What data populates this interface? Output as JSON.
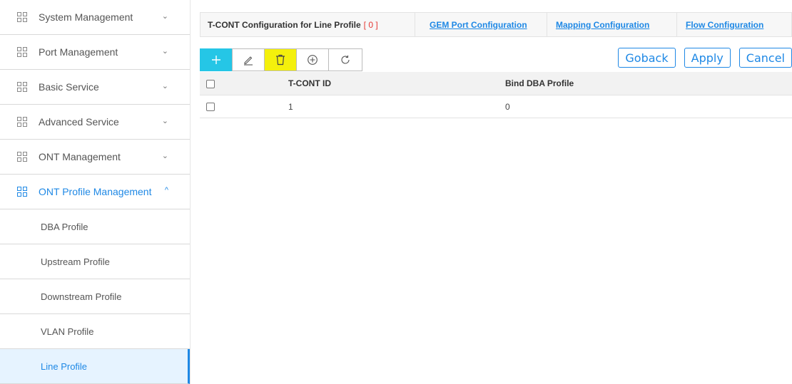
{
  "sidebar": {
    "items": [
      {
        "label": "System Management",
        "chevron": "⌄"
      },
      {
        "label": "Port Management",
        "chevron": "⌄"
      },
      {
        "label": "Basic Service",
        "chevron": "⌄"
      },
      {
        "label": "Advanced Service",
        "chevron": "⌄"
      },
      {
        "label": "ONT Management",
        "chevron": "⌄"
      },
      {
        "label": "ONT Profile Management",
        "chevron": "^"
      }
    ],
    "subitems": [
      {
        "label": "DBA Profile"
      },
      {
        "label": "Upstream Profile"
      },
      {
        "label": "Downstream Profile"
      },
      {
        "label": "VLAN Profile"
      },
      {
        "label": "Line Profile"
      }
    ]
  },
  "tabs": {
    "active_label": "T-CONT Configuration for Line Profile",
    "active_count": "[ 0 ]",
    "gem": "GEM Port Configuration",
    "mapping": "Mapping Configuration",
    "flow": "Flow Configuration"
  },
  "toolbar": {
    "icons": [
      "plus-icon",
      "edit-pencil-icon",
      "trash-icon",
      "circle-plus-icon",
      "refresh-icon"
    ],
    "colors": {
      "add_bg": "#25c6e6",
      "delete_bg": "#f4f00c"
    }
  },
  "actions": {
    "goback": "Goback",
    "apply": "Apply",
    "cancel": "Cancel"
  },
  "table": {
    "headers": [
      "",
      "T-CONT ID",
      "Bind DBA Profile"
    ],
    "rows": [
      {
        "tcont_id": "1",
        "bind_dba_profile": "0"
      }
    ]
  },
  "colors": {
    "accent": "#1e88e5",
    "count_red": "#e53935"
  }
}
